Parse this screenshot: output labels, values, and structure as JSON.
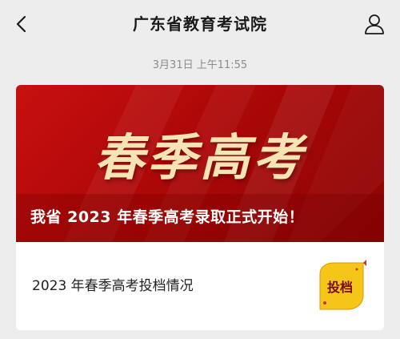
{
  "header": {
    "title": "广东省教育考试院",
    "back_icon": "chevron-left-icon",
    "profile_icon": "person-icon"
  },
  "message": {
    "timestamp": "3月31日 上午11:55"
  },
  "card": {
    "banner_title": "春季高考",
    "banner_subtitle": "我省 2023 年春季高考录取正式开始！",
    "item_label": "2023 年春季高考投档情况",
    "tag_label": "投档"
  },
  "colors": {
    "banner_red": "#c81010",
    "banner_text": "#f6e4b4",
    "tag_yellow": "#f5c518",
    "background": "#ededed"
  }
}
